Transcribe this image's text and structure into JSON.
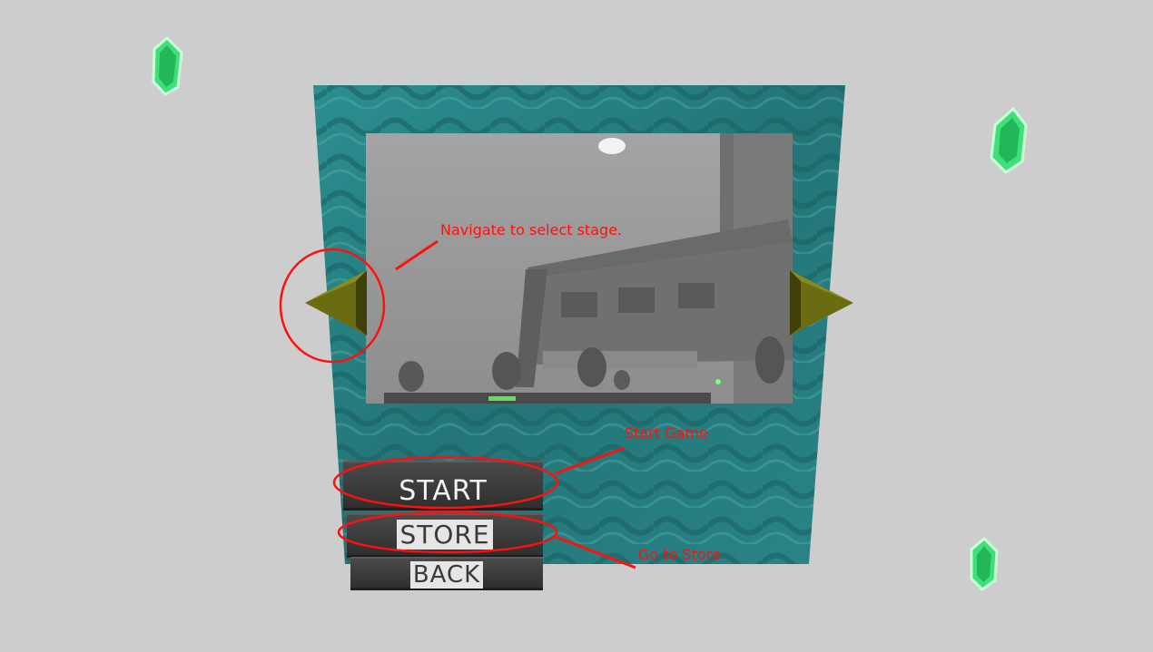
{
  "menu": {
    "start_label": "START",
    "store_label": "STORE",
    "back_label": "BACK"
  },
  "annotations": {
    "navigate_text": "Navigate to select stage.",
    "start_text": "Start Game",
    "store_text": "Go to Store"
  },
  "colors": {
    "background": "#cdcdcd",
    "panel_teal": "#2d8a8c",
    "arrow": "#6b6b12",
    "annotation": "#ff1010",
    "gem": "#3fe07a"
  },
  "icons": [
    "emerald-gem-icon",
    "arrow-left-icon",
    "arrow-right-icon"
  ]
}
